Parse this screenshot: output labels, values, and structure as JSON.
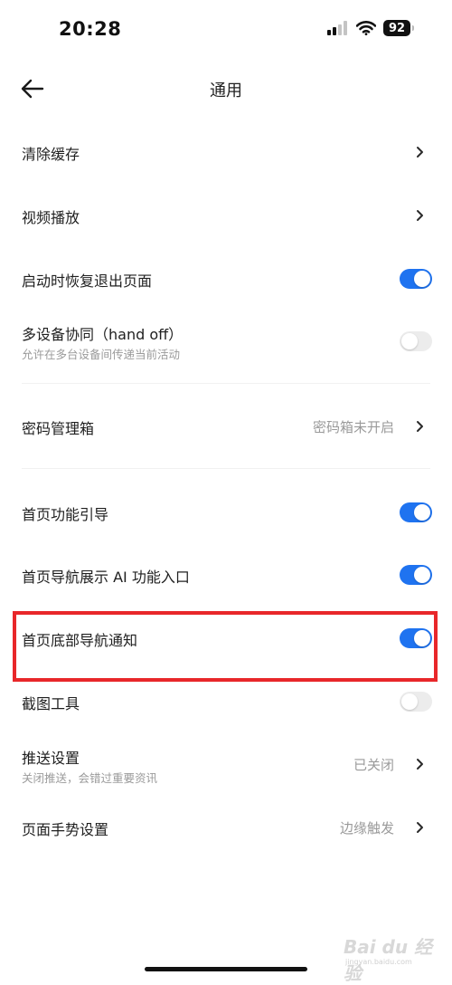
{
  "status_bar": {
    "time": "20:28",
    "battery": "92"
  },
  "header": {
    "title": "通用"
  },
  "settings": {
    "clear_cache": {
      "label": "清除缓存"
    },
    "video_playback": {
      "label": "视频播放"
    },
    "restore_on_launch": {
      "label": "启动时恢复退出页面",
      "enabled": true
    },
    "handoff": {
      "label": "多设备协同（hand off）",
      "subtitle": "允许在多台设备间传递当前活动",
      "enabled": false
    },
    "password_manager": {
      "label": "密码管理箱",
      "value": "密码箱未开启"
    },
    "home_guide": {
      "label": "首页功能引导",
      "enabled": true
    },
    "home_ai_entry": {
      "label": "首页导航展示 AI 功能入口",
      "enabled": true
    },
    "home_bottom_nav_notify": {
      "label": "首页底部导航通知",
      "enabled": true
    },
    "screenshot_tool": {
      "label": "截图工具",
      "enabled": false
    },
    "push_settings": {
      "label": "推送设置",
      "subtitle": "关闭推送，会错过重要资讯",
      "value": "已关闭"
    },
    "gesture_settings": {
      "label": "页面手势设置",
      "value": "边缘触发"
    }
  },
  "colors": {
    "accent": "#1f73f0",
    "toggle_off": "#ececec",
    "highlight": "#e8272a"
  },
  "watermark": {
    "brand": "Bai du 经验",
    "url": "jingyan.baidu.com"
  }
}
